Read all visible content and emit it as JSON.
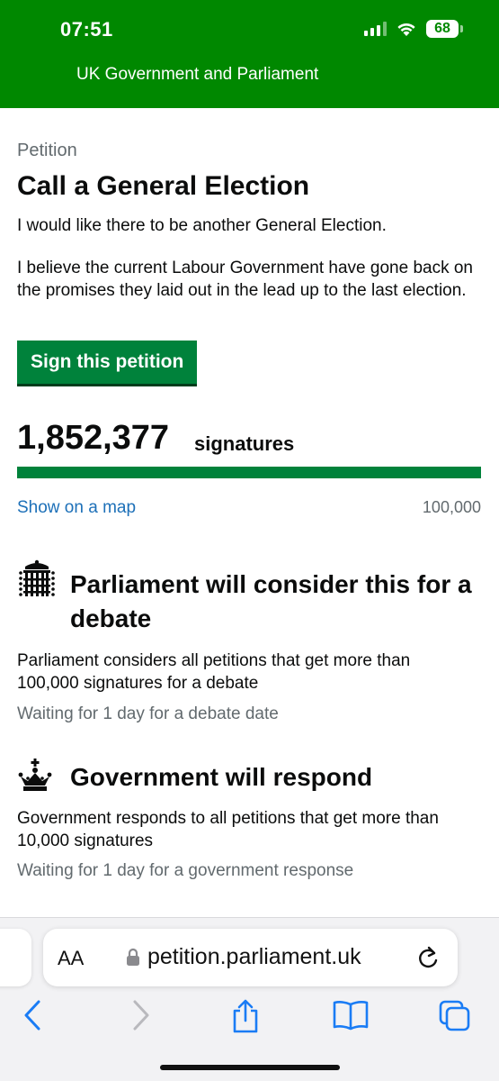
{
  "status_bar": {
    "time": "07:51",
    "battery": "68"
  },
  "site": {
    "title": "UK Government and Parliament"
  },
  "petition": {
    "label": "Petition",
    "title": "Call a General Election",
    "summary": "I would like there to be another General Election.",
    "details": "I believe the current Labour Government have gone back on the promises they laid out in the lead up to the last election.",
    "sign_button": "Sign this petition",
    "signature_count": "1,852,377",
    "signature_word": "signatures",
    "progress_fraction": 1.0,
    "map_link": "Show on a map",
    "threshold": "100,000"
  },
  "debate": {
    "icon": "portcullis-icon",
    "heading": "Parliament will consider this for a debate",
    "text": "Parliament considers all petitions that get more than 100,000 signatures for a debate",
    "status": "Waiting for 1 day for a debate date"
  },
  "response": {
    "icon": "crown-icon",
    "heading": "Government will respond",
    "text": "Government responds to all petitions that get more than 10,000 signatures",
    "status": "Waiting for 1 day for a government response"
  },
  "browser": {
    "text_size_label": "AA",
    "url": "petition.parliament.uk"
  },
  "colors": {
    "header_green": "#008800",
    "button_green": "#00823b",
    "link_blue": "#1d70b8",
    "ios_blue": "#1a7cf5"
  }
}
